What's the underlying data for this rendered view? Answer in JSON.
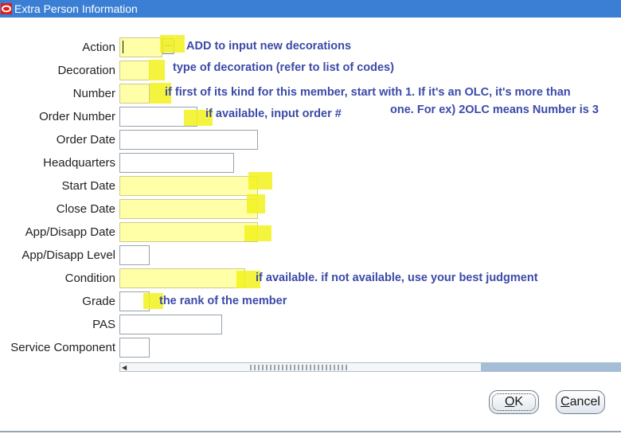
{
  "window": {
    "title": "Extra Person Information"
  },
  "form": {
    "fields": [
      {
        "label": "Action",
        "value": ""
      },
      {
        "label": "Decoration",
        "value": ""
      },
      {
        "label": "Number",
        "value": ""
      },
      {
        "label": "Order Number",
        "value": ""
      },
      {
        "label": "Order Date",
        "value": ""
      },
      {
        "label": "Headquarters",
        "value": ""
      },
      {
        "label": "Start Date",
        "value": ""
      },
      {
        "label": "Close Date",
        "value": ""
      },
      {
        "label": "App/Disapp Date",
        "value": ""
      },
      {
        "label": "App/Disapp Level",
        "value": ""
      },
      {
        "label": "Condition",
        "value": ""
      },
      {
        "label": "Grade",
        "value": ""
      },
      {
        "label": "PAS",
        "value": ""
      },
      {
        "label": "Service Component",
        "value": ""
      }
    ],
    "lov_button_label": "..."
  },
  "annotations": {
    "action": "ADD to input new decorations",
    "decoration": "type of decoration (refer to list of codes)",
    "number_line1": "if first of its kind for this member, start with 1. If it's an OLC, it's more than",
    "number_line2": "one. For ex) 2OLC means Number is 3",
    "order_number": "if available, input order #",
    "condition": "if available. if not available, use your best judgment",
    "grade": "the rank of the member"
  },
  "buttons": {
    "ok_underlined": "O",
    "ok_rest": "K",
    "cancel_underlined": "C",
    "cancel_rest": "ancel"
  },
  "colors": {
    "titlebar": "#3a7fd4",
    "required_field": "#ffffa8",
    "highlight": "#f2f21c",
    "annotation_text": "#3b4aa8"
  }
}
